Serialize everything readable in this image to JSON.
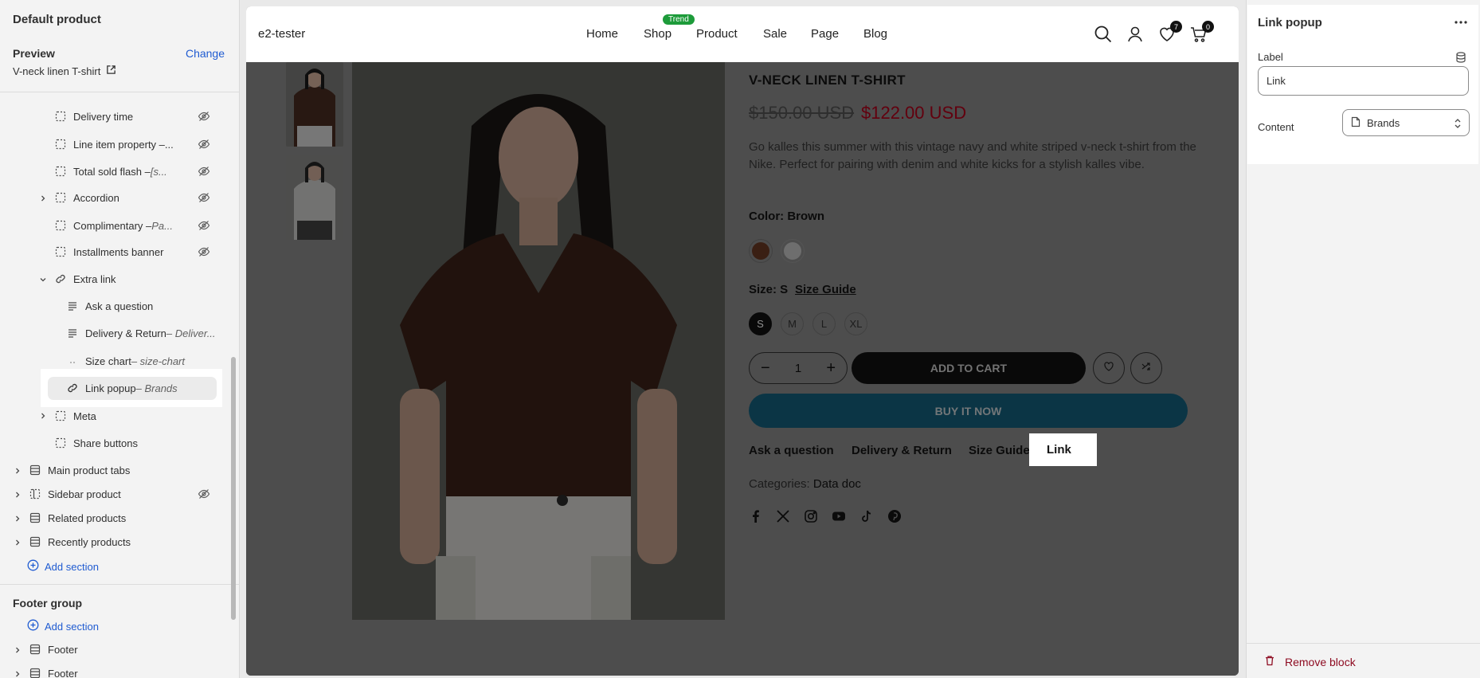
{
  "sidebar": {
    "title": "Default product",
    "preview_label": "Preview",
    "change_label": "Change",
    "product_name": "V-neck linen T-shirt",
    "items": [
      {
        "label": "Delivery time",
        "sub": ""
      },
      {
        "label": "Line item property –...",
        "sub": ""
      },
      {
        "label": "Total sold flash – ",
        "sub": "[s..."
      },
      {
        "label": "Accordion",
        "sub": ""
      },
      {
        "label": "Complimentary – ",
        "sub": "Pa..."
      },
      {
        "label": "Installments banner",
        "sub": ""
      },
      {
        "label": "Extra link",
        "sub": ""
      },
      {
        "label": "Ask a question",
        "sub": ""
      },
      {
        "label": "Delivery & Return",
        "sub": " – Deliver..."
      },
      {
        "label": "Size chart",
        "sub": " – size-chart"
      },
      {
        "label": "Link popup",
        "sub": " – Brands"
      },
      {
        "label": "Meta",
        "sub": ""
      },
      {
        "label": "Share buttons",
        "sub": ""
      },
      {
        "label": "Main product tabs",
        "sub": ""
      },
      {
        "label": "Sidebar product",
        "sub": ""
      },
      {
        "label": "Related products",
        "sub": ""
      },
      {
        "label": "Recently products",
        "sub": ""
      }
    ],
    "add_section_label": "Add section",
    "footer_group_title": "Footer group",
    "footer_add_section_label": "Add section",
    "footer_items": [
      "Footer",
      "Footer"
    ]
  },
  "store": {
    "brand": "e2-tester",
    "nav": [
      "Home",
      "Shop",
      "Product",
      "Sale",
      "Page",
      "Blog"
    ],
    "trend_badge": "Trend",
    "wishlist_count": "7",
    "cart_count": "0"
  },
  "product": {
    "title": "V-NECK LINEN T-SHIRT",
    "old_price": "$150.00 USD",
    "new_price": "$122.00 USD",
    "description": "Go kalles this summer with this vintage navy and white striped v-neck t-shirt from the Nike. Perfect for pairing with denim and white kicks for a stylish kalles vibe.",
    "color_label": "Color: Brown",
    "colors": [
      "#6b3a24",
      "#ffffff"
    ],
    "size_label": "Size: S",
    "size_guide": "Size Guide",
    "sizes": [
      "S",
      "M",
      "L",
      "XL"
    ],
    "quantity": "1",
    "add_to_cart": "ADD TO CART",
    "buy_it_now": "BUY IT NOW",
    "extra_links": [
      "Ask a question",
      "Delivery & Return",
      "Size Guide"
    ],
    "link_label": "Link",
    "categories_label": "Categories:",
    "categories_value": "Data doc",
    "social_icons": [
      "facebook-icon",
      "x-icon",
      "instagram-icon",
      "youtube-icon",
      "tiktok-icon",
      "pinterest-icon"
    ]
  },
  "panel": {
    "title": "Link popup",
    "label_field_label": "Label",
    "label_value": "Link",
    "content_label": "Content",
    "content_value": "Brands",
    "remove_label": "Remove block"
  },
  "colors": {
    "accent_blue": "#1f5bd1",
    "sale_red": "#b3001b",
    "buy_now": "#15617f",
    "remove_red": "#8e0b21"
  }
}
